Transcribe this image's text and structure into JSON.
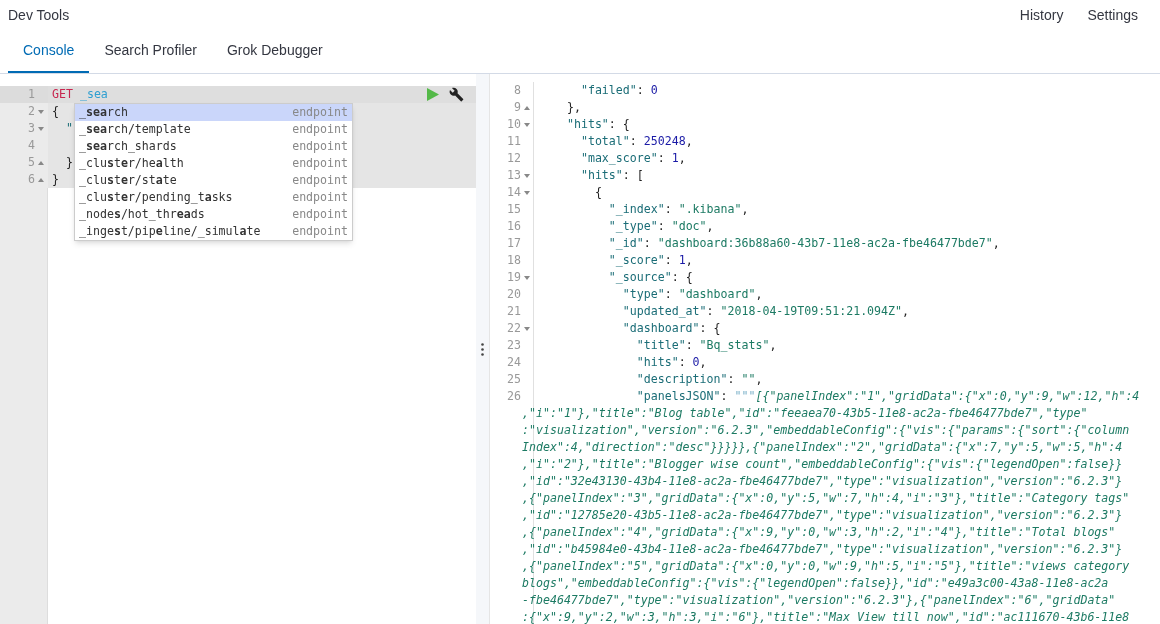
{
  "app_title": "Dev Tools",
  "header_links": [
    "History",
    "Settings"
  ],
  "tabs": [
    {
      "label": "Console",
      "selected": true
    },
    {
      "label": "Search Profiler",
      "selected": false
    },
    {
      "label": "Grok Debugger",
      "selected": false
    }
  ],
  "editor": {
    "lines": [
      {
        "number": "1",
        "fold_start": false,
        "fold_end": false,
        "current": true,
        "parts": [
          {
            "kind": "method",
            "text": "GET"
          },
          {
            "kind": "url",
            "text": " _sea"
          }
        ]
      },
      {
        "number": "2",
        "fold_start": true,
        "fold_end": false,
        "current": false,
        "parts": [
          {
            "kind": "punct",
            "text": "{"
          }
        ]
      },
      {
        "number": "3",
        "fold_start": true,
        "fold_end": false,
        "current": false,
        "parts": [
          {
            "kind": "key",
            "text": "  \""
          }
        ]
      },
      {
        "number": "4",
        "fold_start": false,
        "fold_end": false,
        "current": false
      },
      {
        "number": "5",
        "fold_start": false,
        "fold_end": true,
        "current": false,
        "parts": [
          {
            "kind": "punct",
            "text": "  }"
          }
        ]
      },
      {
        "number": "6",
        "fold_start": false,
        "fold_end": true,
        "current": false,
        "parts": [
          {
            "kind": "punct",
            "text": "}"
          }
        ]
      }
    ],
    "autocomplete": [
      {
        "text": "_**sea**rch",
        "meta": "endpoint",
        "selected": true
      },
      {
        "text": "_**sea**rch/template",
        "meta": "endpoint",
        "selected": false
      },
      {
        "text": "_**sea**rch_shards",
        "meta": "endpoint",
        "selected": false
      },
      {
        "text": "_clu**s**t**e**r/he**a**lth",
        "meta": "endpoint",
        "selected": false
      },
      {
        "text": "_clu**s**t**e**r/st**a**te",
        "meta": "endpoint",
        "selected": false
      },
      {
        "text": "_clu**s**t**e**r/pending_t**a**sks",
        "meta": "endpoint",
        "selected": false
      },
      {
        "text": "_node**s**/hot_thr**ea**ds",
        "meta": "endpoint",
        "selected": false
      },
      {
        "text": "_inge**s**t/pip**e**line/_simul**a**te",
        "meta": "endpoint",
        "selected": false
      }
    ]
  },
  "output": {
    "lines": [
      {
        "number": "8",
        "fold_start": false,
        "fold_end": false,
        "parts": [
          {
            "kind": "key",
            "text": "    \"failed\""
          },
          {
            "kind": "punct",
            "text": ": "
          },
          {
            "kind": "number",
            "text": "0"
          }
        ]
      },
      {
        "number": "9",
        "fold_start": false,
        "fold_end": true,
        "parts": [
          {
            "kind": "punct",
            "text": "  },"
          }
        ]
      },
      {
        "number": "10",
        "fold_start": true,
        "fold_end": false,
        "parts": [
          {
            "kind": "key",
            "text": "  \"hits\""
          },
          {
            "kind": "punct",
            "text": ": {"
          }
        ]
      },
      {
        "number": "11",
        "fold_start": false,
        "fold_end": false,
        "parts": [
          {
            "kind": "key",
            "text": "    \"total\""
          },
          {
            "kind": "punct",
            "text": ": "
          },
          {
            "kind": "number",
            "text": "250248"
          },
          {
            "kind": "punct",
            "text": ","
          }
        ]
      },
      {
        "number": "12",
        "fold_start": false,
        "fold_end": false,
        "parts": [
          {
            "kind": "key",
            "text": "    \"max_score\""
          },
          {
            "kind": "punct",
            "text": ": "
          },
          {
            "kind": "number",
            "text": "1"
          },
          {
            "kind": "punct",
            "text": ","
          }
        ]
      },
      {
        "number": "13",
        "fold_start": true,
        "fold_end": false,
        "parts": [
          {
            "kind": "key",
            "text": "    \"hits\""
          },
          {
            "kind": "punct",
            "text": ": ["
          }
        ]
      },
      {
        "number": "14",
        "fold_start": true,
        "fold_end": false,
        "parts": [
          {
            "kind": "punct",
            "text": "      {"
          }
        ]
      },
      {
        "number": "15",
        "fold_start": false,
        "fold_end": false,
        "parts": [
          {
            "kind": "key",
            "text": "        \"_index\""
          },
          {
            "kind": "punct",
            "text": ": "
          },
          {
            "kind": "string",
            "text": "\".kibana\""
          },
          {
            "kind": "punct",
            "text": ","
          }
        ]
      },
      {
        "number": "16",
        "fold_start": false,
        "fold_end": false,
        "parts": [
          {
            "kind": "key",
            "text": "        \"_type\""
          },
          {
            "kind": "punct",
            "text": ": "
          },
          {
            "kind": "string",
            "text": "\"doc\""
          },
          {
            "kind": "punct",
            "text": ","
          }
        ]
      },
      {
        "number": "17",
        "fold_start": false,
        "fold_end": false,
        "parts": [
          {
            "kind": "key",
            "text": "        \"_id\""
          },
          {
            "kind": "punct",
            "text": ": "
          },
          {
            "kind": "string",
            "text": "\"dashboard:36b88a60-43b7-11e8-ac2a-fbe46477bde7\""
          },
          {
            "kind": "punct",
            "text": ","
          }
        ]
      },
      {
        "number": "18",
        "fold_start": false,
        "fold_end": false,
        "parts": [
          {
            "kind": "key",
            "text": "        \"_score\""
          },
          {
            "kind": "punct",
            "text": ": "
          },
          {
            "kind": "number",
            "text": "1"
          },
          {
            "kind": "punct",
            "text": ","
          }
        ]
      },
      {
        "number": "19",
        "fold_start": true,
        "fold_end": false,
        "parts": [
          {
            "kind": "key",
            "text": "        \"_source\""
          },
          {
            "kind": "punct",
            "text": ": {"
          }
        ]
      },
      {
        "number": "20",
        "fold_start": false,
        "fold_end": false,
        "parts": [
          {
            "kind": "key",
            "text": "          \"type\""
          },
          {
            "kind": "punct",
            "text": ": "
          },
          {
            "kind": "string",
            "text": "\"dashboard\""
          },
          {
            "kind": "punct",
            "text": ","
          }
        ]
      },
      {
        "number": "21",
        "fold_start": false,
        "fold_end": false,
        "parts": [
          {
            "kind": "key",
            "text": "          \"updated_at\""
          },
          {
            "kind": "punct",
            "text": ": "
          },
          {
            "kind": "string",
            "text": "\"2018-04-19T09:51:21.094Z\""
          },
          {
            "kind": "punct",
            "text": ","
          }
        ]
      },
      {
        "number": "22",
        "fold_start": true,
        "fold_end": false,
        "parts": [
          {
            "kind": "key",
            "text": "          \"dashboard\""
          },
          {
            "kind": "punct",
            "text": ": {"
          }
        ]
      },
      {
        "number": "23",
        "fold_start": false,
        "fold_end": false,
        "parts": [
          {
            "kind": "key",
            "text": "            \"title\""
          },
          {
            "kind": "punct",
            "text": ": "
          },
          {
            "kind": "string",
            "text": "\"Bq_stats\""
          },
          {
            "kind": "punct",
            "text": ","
          }
        ]
      },
      {
        "number": "24",
        "fold_start": false,
        "fold_end": false,
        "parts": [
          {
            "kind": "key",
            "text": "            \"hits\""
          },
          {
            "kind": "punct",
            "text": ": "
          },
          {
            "kind": "number",
            "text": "0"
          },
          {
            "kind": "punct",
            "text": ","
          }
        ]
      },
      {
        "number": "25",
        "fold_start": false,
        "fold_end": false,
        "parts": [
          {
            "kind": "key",
            "text": "            \"description\""
          },
          {
            "kind": "punct",
            "text": ": "
          },
          {
            "kind": "string",
            "text": "\"\""
          },
          {
            "kind": "punct",
            "text": ","
          }
        ]
      },
      {
        "number": "26",
        "fold_start": false,
        "fold_end": false,
        "parts": [
          {
            "kind": "key",
            "text": "            \"panelsJSON\""
          },
          {
            "kind": "punct",
            "text": ": "
          },
          {
            "kind": "quote",
            "text": "\"\"\""
          },
          {
            "kind": "multiline",
            "text": "[{\"panelIndex\":\"1\",\"gridData\":{\"x\":0,\"y\":9,\"w\":12,\"h\":4"
          }
        ],
        "wrapped": [
          ",\"i\":\"1\"},\"title\":\"Blog table\",\"id\":\"feeaea70-43b5-11e8-ac2a-fbe46477bde7\",\"type\"",
          ":\"visualization\",\"version\":\"6.2.3\",\"embeddableConfig\":{\"vis\":{\"params\":{\"sort\":{\"column",
          "Index\":4,\"direction\":\"desc\"}}}}},{\"panelIndex\":\"2\",\"gridData\":{\"x\":7,\"y\":5,\"w\":5,\"h\":4",
          ",\"i\":\"2\"},\"title\":\"Blogger wise count\",\"embeddableConfig\":{\"vis\":{\"legendOpen\":false}}",
          ",\"id\":\"32e43130-43b4-11e8-ac2a-fbe46477bde7\",\"type\":\"visualization\",\"version\":\"6.2.3\"}",
          ",{\"panelIndex\":\"3\",\"gridData\":{\"x\":0,\"y\":5,\"w\":7,\"h\":4,\"i\":\"3\"},\"title\":\"Category tags\"",
          ",\"id\":\"12785e20-43b5-11e8-ac2a-fbe46477bde7\",\"type\":\"visualization\",\"version\":\"6.2.3\"}",
          ",{\"panelIndex\":\"4\",\"gridData\":{\"x\":9,\"y\":0,\"w\":3,\"h\":2,\"i\":\"4\"},\"title\":\"Total blogs\"",
          ",\"id\":\"b45984e0-43b4-11e8-ac2a-fbe46477bde7\",\"type\":\"visualization\",\"version\":\"6.2.3\"}",
          ",{\"panelIndex\":\"5\",\"gridData\":{\"x\":0,\"y\":0,\"w\":9,\"h\":5,\"i\":\"5\"},\"title\":\"views category",
          "blogs\",\"embeddableConfig\":{\"vis\":{\"legendOpen\":false}},\"id\":\"e49a3c00-43a8-11e8-ac2a",
          "-fbe46477bde7\",\"type\":\"visualization\",\"version\":\"6.2.3\"},{\"panelIndex\":\"6\",\"gridData\"",
          ":{\"x\":9,\"y\":2,\"w\":3,\"h\":3,\"i\":\"6\"},\"title\":\"Max View till now\",\"id\":\"ac111670-43b6-11e8"
        ]
      }
    ]
  }
}
